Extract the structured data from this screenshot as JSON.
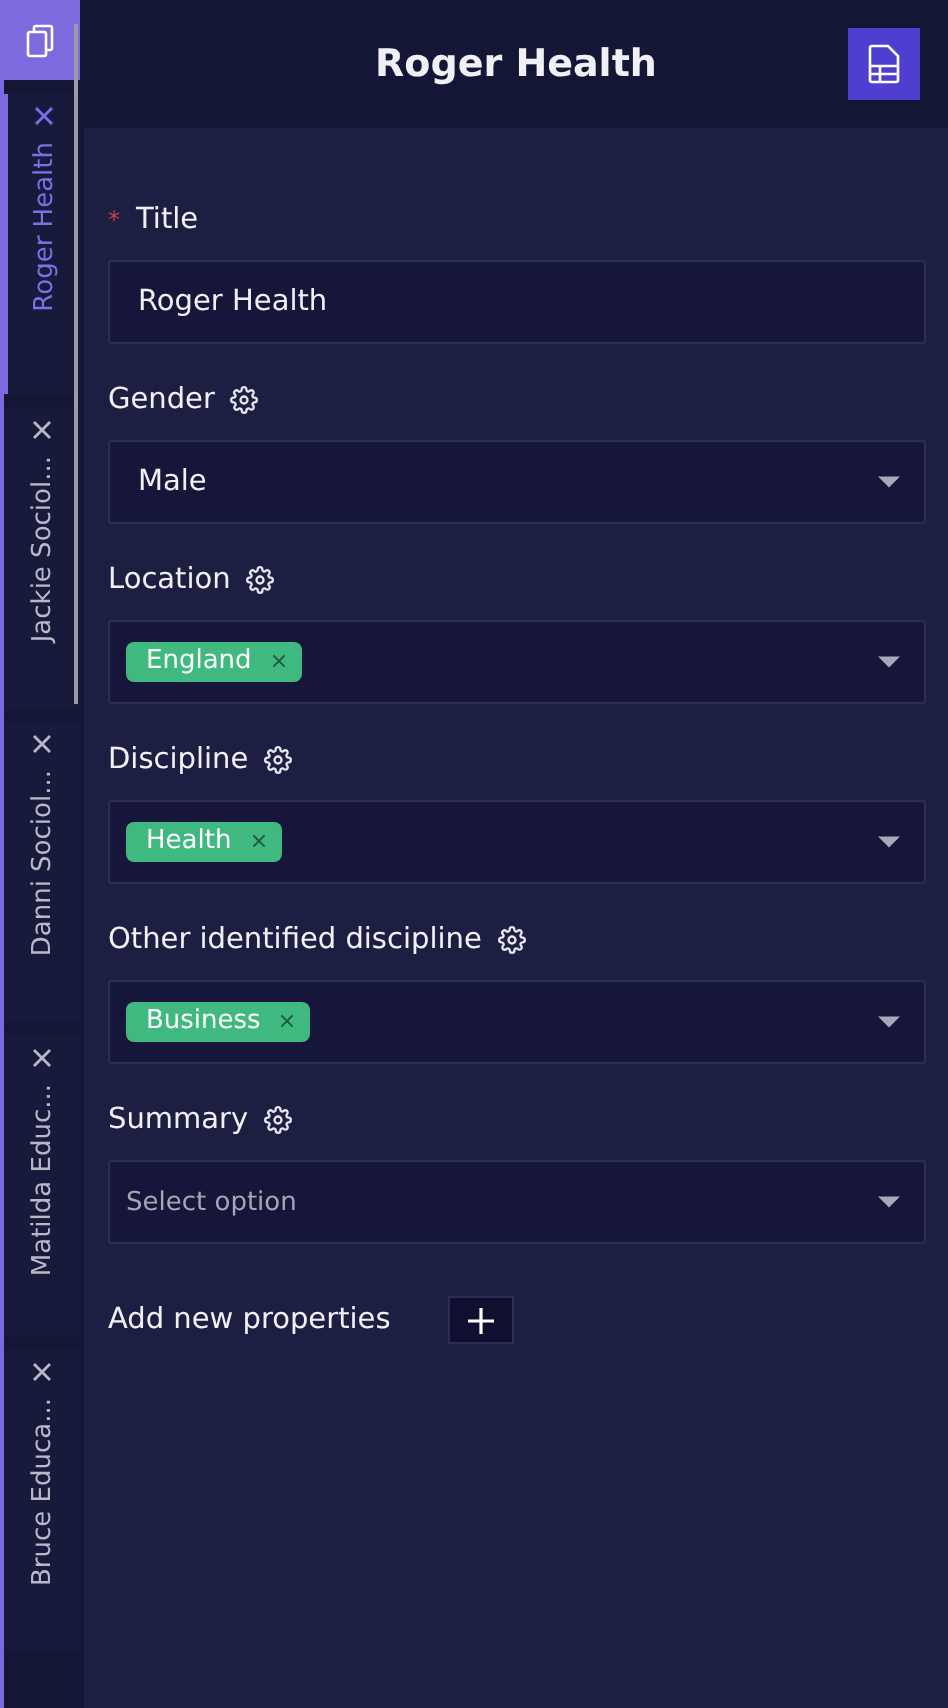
{
  "tabs": [
    {
      "label": "Roger Health",
      "selected": true
    },
    {
      "label": "Jackie Sociol...",
      "selected": false
    },
    {
      "label": "Danni Sociol...",
      "selected": false
    },
    {
      "label": "Matilda Educ...",
      "selected": false
    },
    {
      "label": "Bruce Educa...",
      "selected": false
    }
  ],
  "header": {
    "title": "Roger Health"
  },
  "fields": [
    {
      "label": "Title",
      "required_mark": "*",
      "settings": false,
      "kind": "text",
      "value": "Roger Health"
    },
    {
      "label": "Gender",
      "settings": true,
      "kind": "select",
      "value": "Male"
    },
    {
      "label": "Location",
      "settings": true,
      "kind": "tags",
      "tags": [
        "England"
      ]
    },
    {
      "label": "Discipline",
      "settings": true,
      "kind": "tags",
      "tags": [
        "Health"
      ]
    },
    {
      "label": "Other identified discipline",
      "settings": true,
      "kind": "tags",
      "tags": [
        "Business"
      ]
    },
    {
      "label": "Summary",
      "settings": true,
      "kind": "select",
      "placeholder": "Select option"
    }
  ],
  "add_properties": {
    "label": "Add new properties"
  }
}
